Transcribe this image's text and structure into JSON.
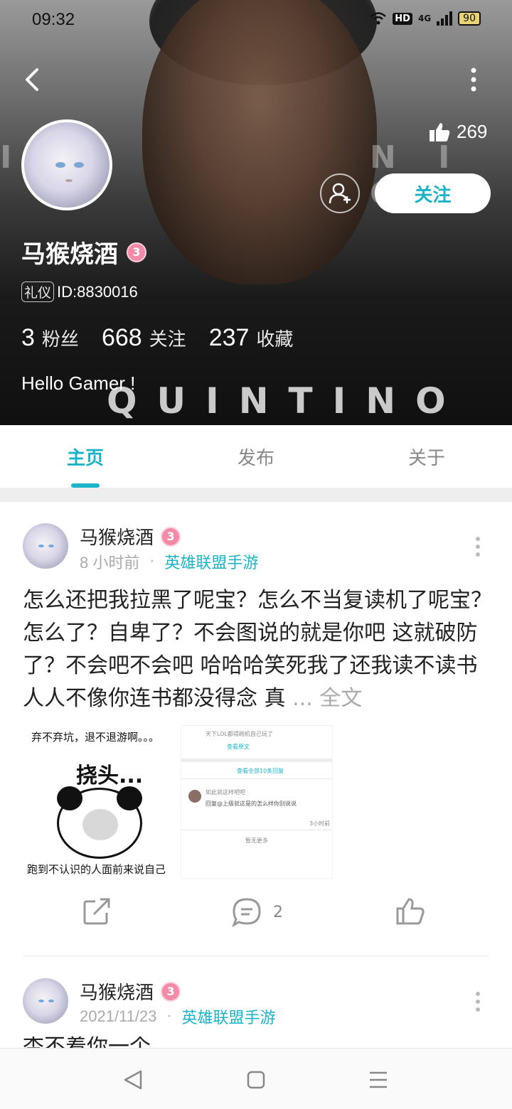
{
  "status_bar": {
    "time": "09:32",
    "network_label": "HD",
    "signal_label": "4G",
    "battery": "90"
  },
  "header": {
    "background_words": {
      "left": "I   T",
      "right": "N I G H",
      "bottom": "QUINTINO"
    },
    "likes_count": "269",
    "follow_label": "关注",
    "username": "马猴烧酒",
    "level": "3",
    "role_tag": "礼仪",
    "id_text": "ID:8830016",
    "stats": [
      {
        "num": "3",
        "label": "粉丝"
      },
      {
        "num": "668",
        "label": "关注"
      },
      {
        "num": "237",
        "label": "收藏"
      }
    ],
    "bio": "Hello Gamer !"
  },
  "tabs": [
    {
      "label": "主页",
      "active": true
    },
    {
      "label": "发布",
      "active": false
    },
    {
      "label": "关于",
      "active": false
    }
  ],
  "posts": [
    {
      "author": "马猴烧酒",
      "level": "3",
      "time": "8 小时前",
      "topic": "英雄联盟手游",
      "text": "怎么还把我拉黑了呢宝？怎么不当复读机了呢宝？怎么了？自卑了？不会图说的就是你吧 这就破防了？不会吧不会吧 哈哈哈笑死我了还我读不读书 人人不像你连书都没得念 真 ",
      "more_label": "... 全文",
      "image1": {
        "top_text": "弃不弃坑，退不退游啊。。。",
        "mid_text": "挠头...",
        "bottom_text": "跑到不认识的人面前来说自己"
      },
      "image2": {
        "line1": "天下LOL都得刷机自己玩了",
        "link1": "查看原文",
        "header": "查看全部10条回复",
        "reply_name": "如此就这样吧吧",
        "reply_text": "回复@上级就这是的怎么样你别说说",
        "reply_time": "3小时前",
        "footer": "暂无更多"
      },
      "comment_count": "2"
    },
    {
      "author": "马猴烧酒",
      "level": "3",
      "time": "2021/11/23",
      "topic": "英雄联盟手游",
      "text_peek": "杏不着你一个"
    }
  ],
  "colors": {
    "accent": "#1bb3c8",
    "level_badge": "#f48aa8"
  },
  "icons": [
    "back-arrow-icon",
    "more-vertical-icon",
    "thumbs-up-icon",
    "add-friend-icon",
    "share-icon",
    "comment-icon",
    "like-icon",
    "nav-back-icon",
    "nav-home-icon",
    "nav-menu-icon"
  ]
}
